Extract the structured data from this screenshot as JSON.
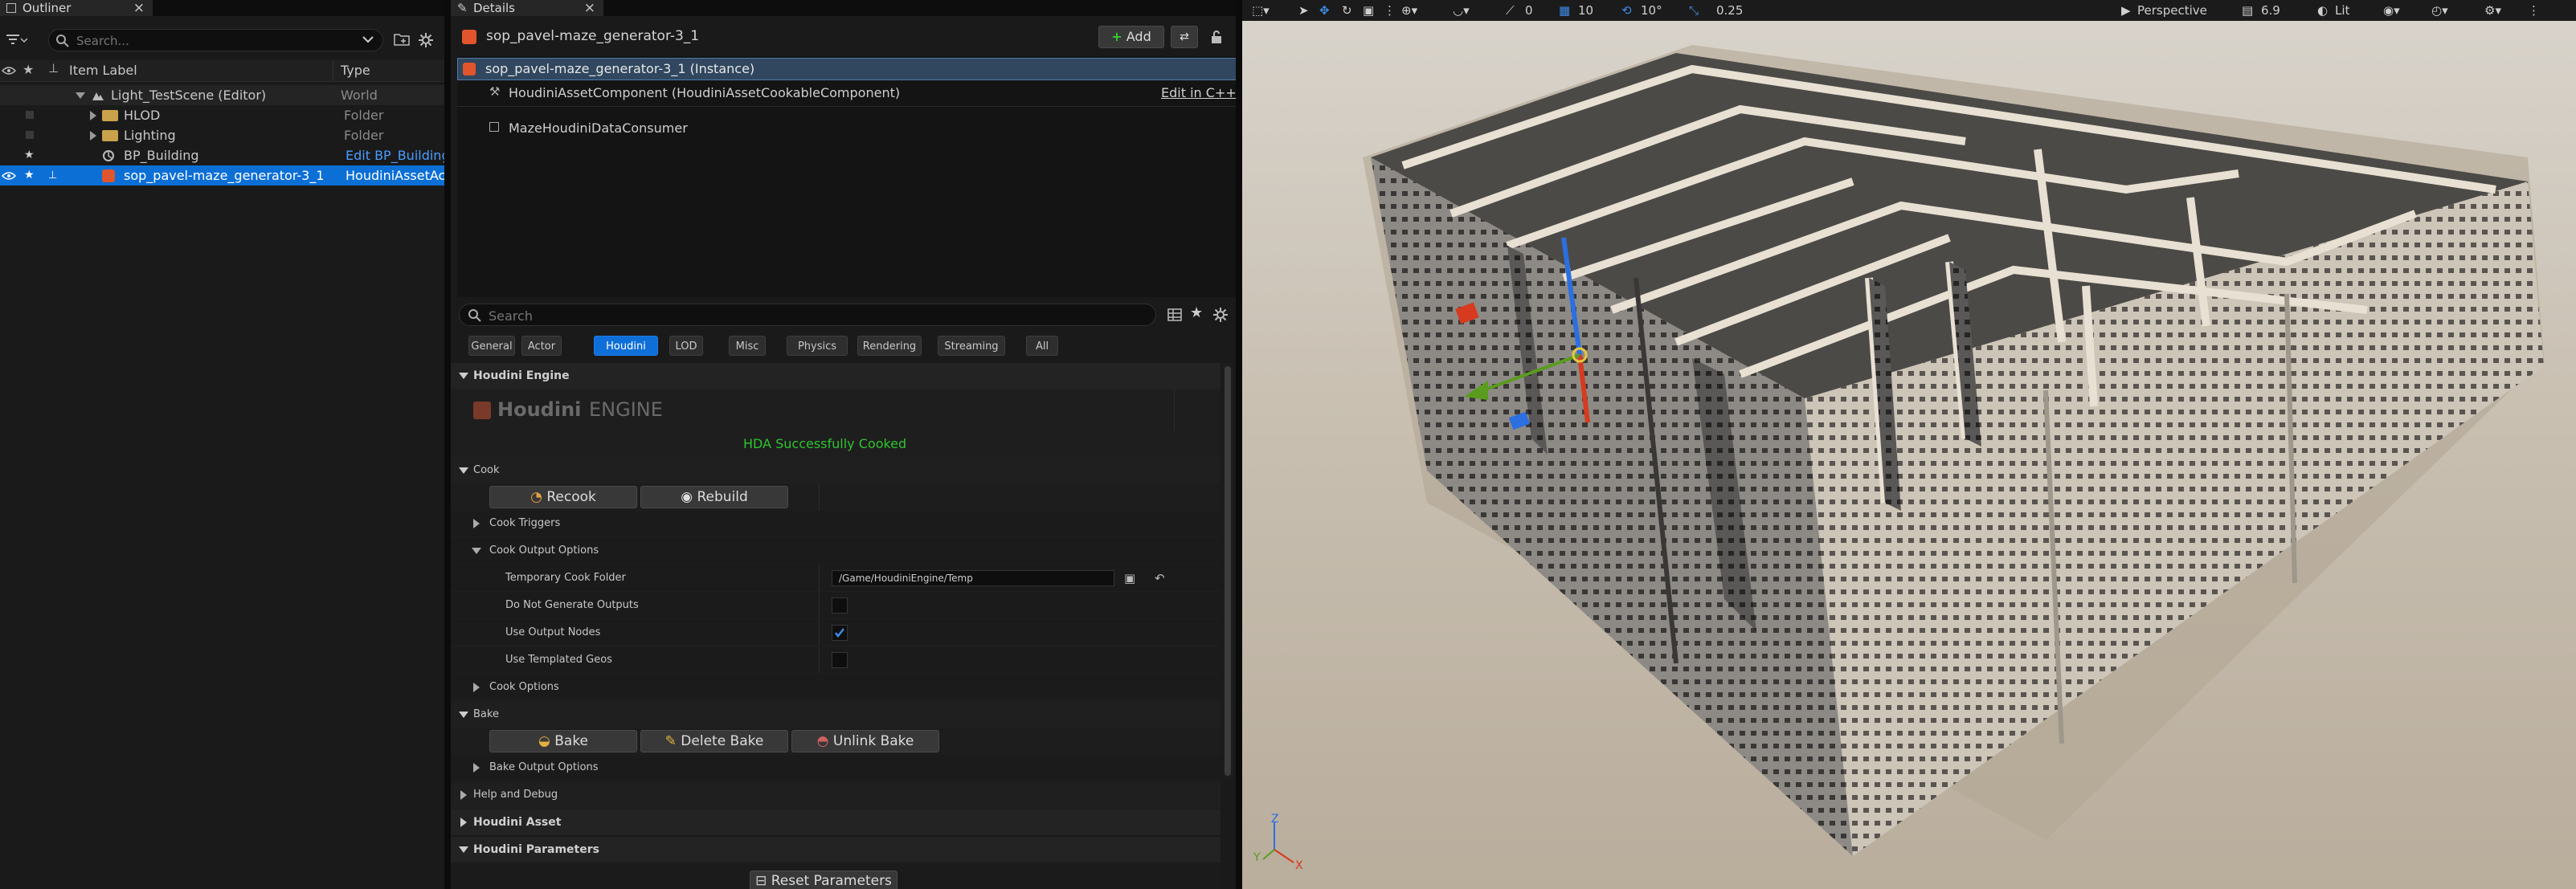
{
  "outliner": {
    "tab_title": "Outliner",
    "search_placeholder": "Search...",
    "col_item": "Item Label",
    "col_type": "Type",
    "rows": [
      {
        "label": "Light_TestScene (Editor)",
        "type": "World"
      },
      {
        "label": "HLOD",
        "type": "Folder"
      },
      {
        "label": "Lighting",
        "type": "Folder"
      },
      {
        "label": "BP_Building",
        "type": "Edit BP_Building"
      },
      {
        "label": "sop_pavel-maze_generator-3_1",
        "type": "HoudiniAssetAc"
      }
    ]
  },
  "details": {
    "tab_title": "Details",
    "actor_name": "sop_pavel-maze_generator-3_1",
    "add_label": "Add",
    "components": {
      "instance": "sop_pavel-maze_generator-3_1 (Instance)",
      "houdini_component": "HoudiniAssetComponent (HoudiniAssetCookableComponent)",
      "edit_cpp": "Edit in C++",
      "maze_consumer": "MazeHoudiniDataConsumer"
    },
    "search_placeholder": "Search",
    "filters": [
      "General",
      "Actor",
      "Houdini",
      "LOD",
      "Misc",
      "Physics",
      "Rendering",
      "Streaming",
      "All"
    ],
    "active_filter": "Houdini",
    "section_houdini_engine": "Houdini Engine",
    "logo_houdini": "Houdini",
    "logo_engine": "ENGINE",
    "status": "HDA Successfully Cooked",
    "cook": {
      "title": "Cook",
      "recook": "Recook",
      "rebuild": "Rebuild",
      "triggers": "Cook Triggers",
      "output_options": "Cook Output Options",
      "temp_folder_label": "Temporary Cook Folder",
      "temp_folder_value": "/Game/HoudiniEngine/Temp",
      "no_outputs": "Do Not Generate Outputs",
      "use_output_nodes": "Use Output Nodes",
      "use_templated": "Use Templated Geos",
      "cook_options": "Cook Options"
    },
    "bake": {
      "title": "Bake",
      "bake": "Bake",
      "delete_bake": "Delete Bake",
      "unlink_bake": "Unlink Bake",
      "output_options": "Bake Output Options"
    },
    "help_debug": "Help and Debug",
    "houdini_asset": "Houdini Asset",
    "houdini_parameters": "Houdini Parameters",
    "reset_parameters": "Reset Parameters"
  },
  "viewport": {
    "rot_snap": "0",
    "grid_snap": "10",
    "angle_snap": "10°",
    "scale_snap": "0.25",
    "view_mode": "Perspective",
    "fov": "6.9",
    "lit": "Lit",
    "axis_z": "Z",
    "axis_x": "X",
    "axis_y": "Y"
  },
  "colors": {
    "accent": "#0c6fd6",
    "success": "#2ec42e",
    "folder": "#c9a24b"
  }
}
